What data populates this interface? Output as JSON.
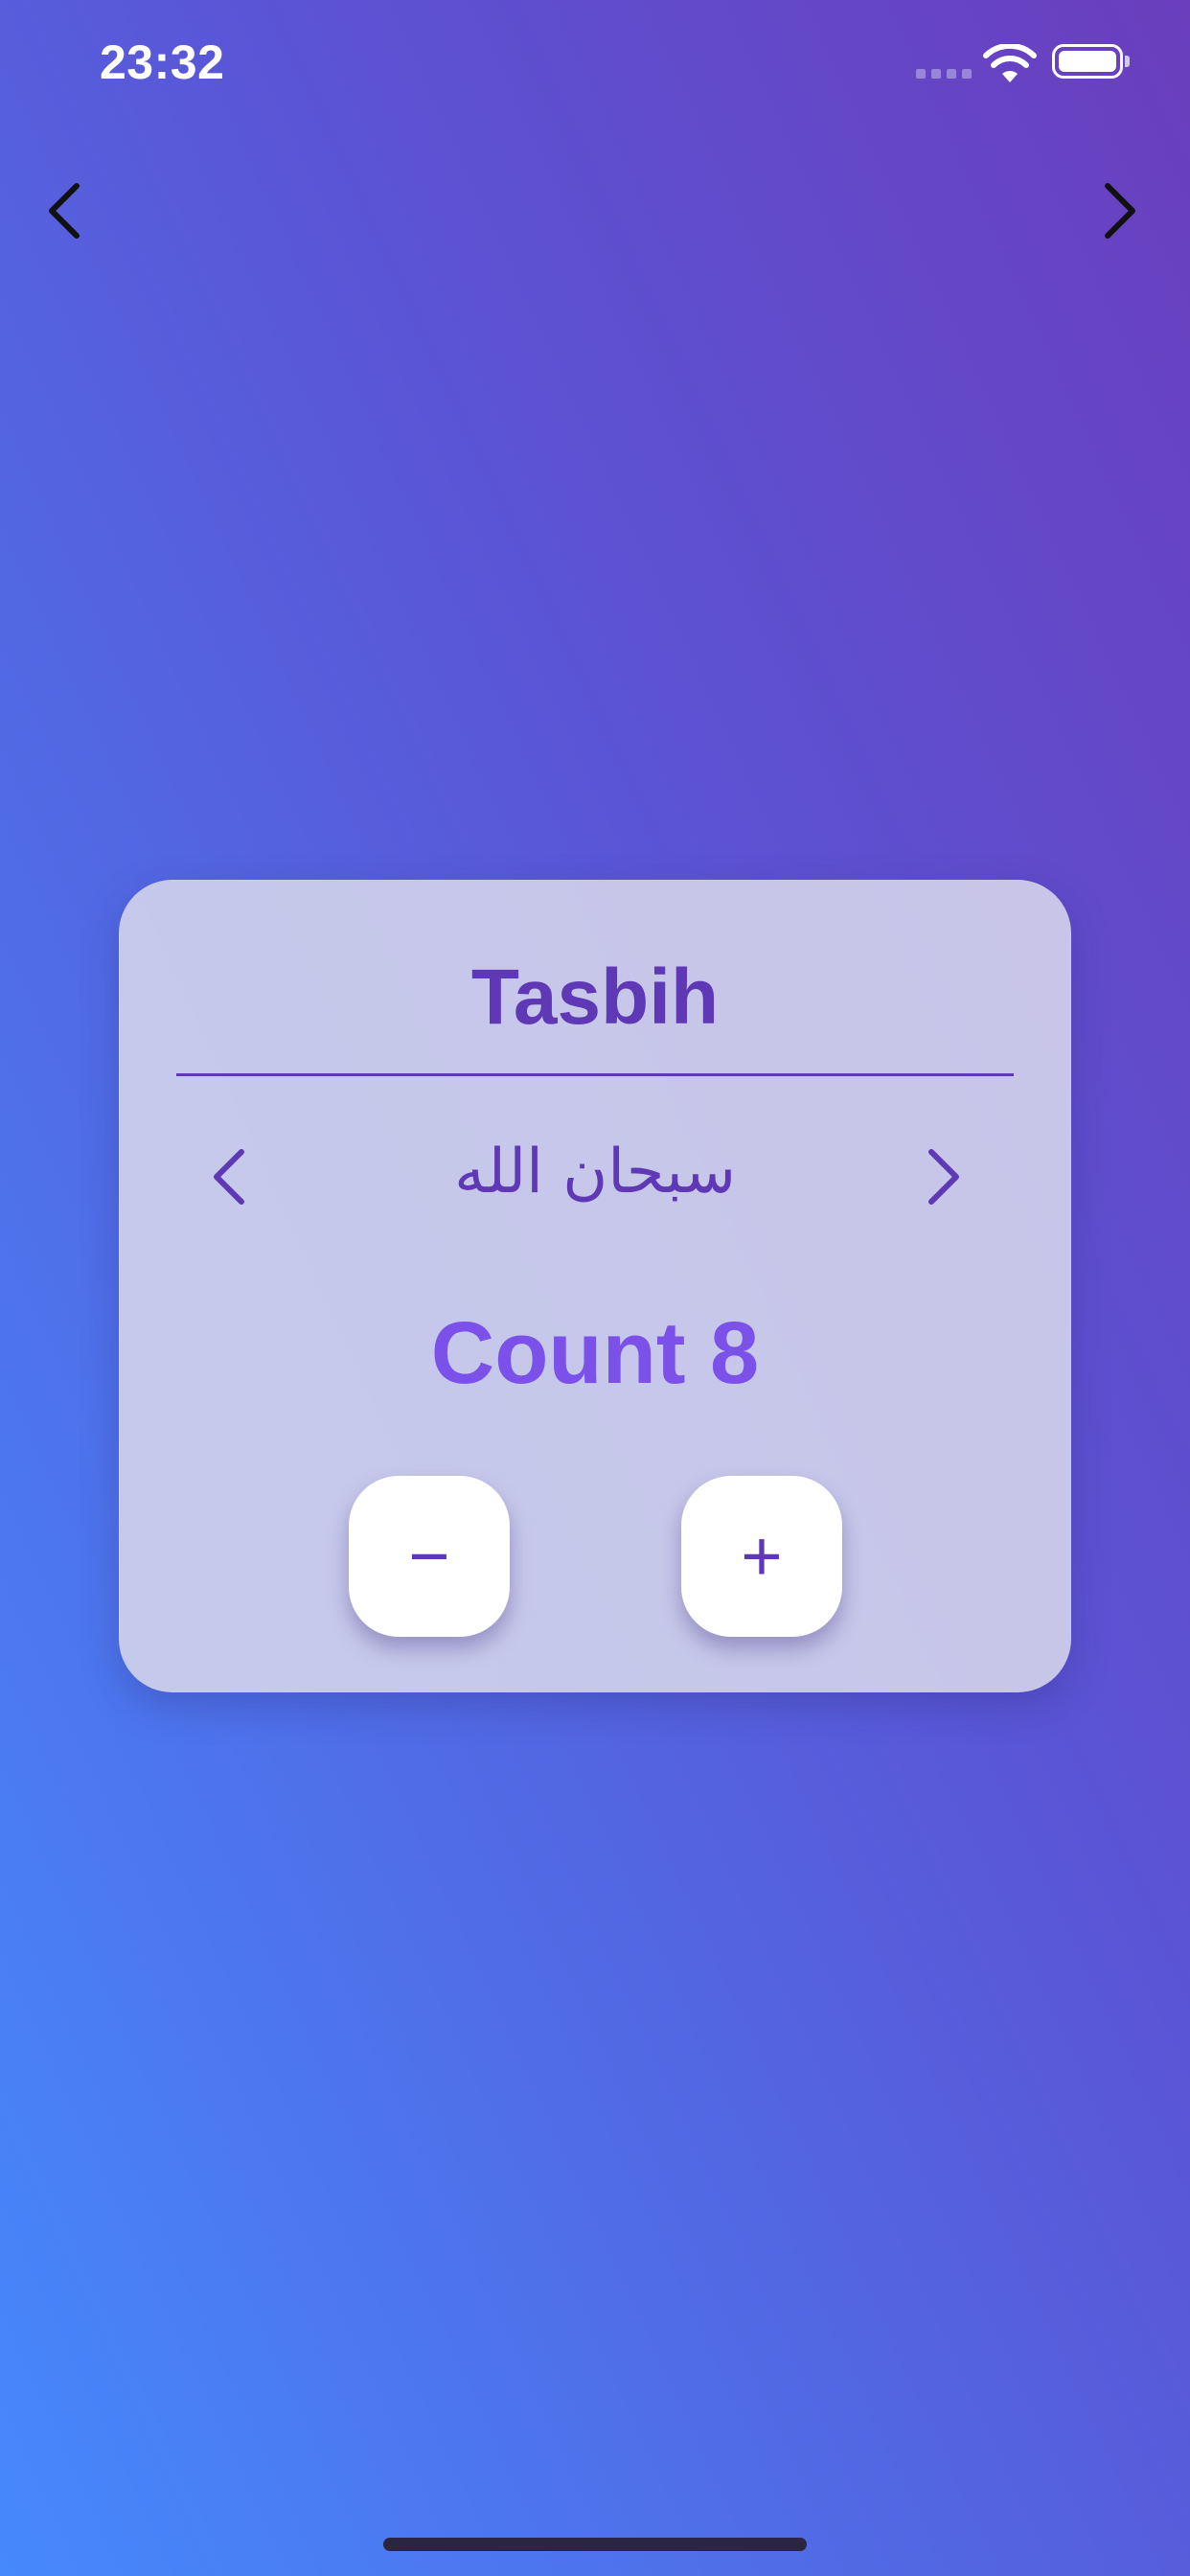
{
  "status_bar": {
    "time": "23:32"
  },
  "nav": {
    "prev_icon": "chevron-left-icon",
    "next_icon": "chevron-right-icon"
  },
  "card": {
    "title": "Tasbih",
    "dhikr": "سبحان الله",
    "count_label": "Count 8",
    "decrement_label": "−",
    "increment_label": "+"
  },
  "colors": {
    "accent": "#5f38b5",
    "count": "#7b51ea",
    "card_bg": "#d6d6ec",
    "gradient_top": "#6a3ebd",
    "gradient_bottom": "#4689fd"
  }
}
